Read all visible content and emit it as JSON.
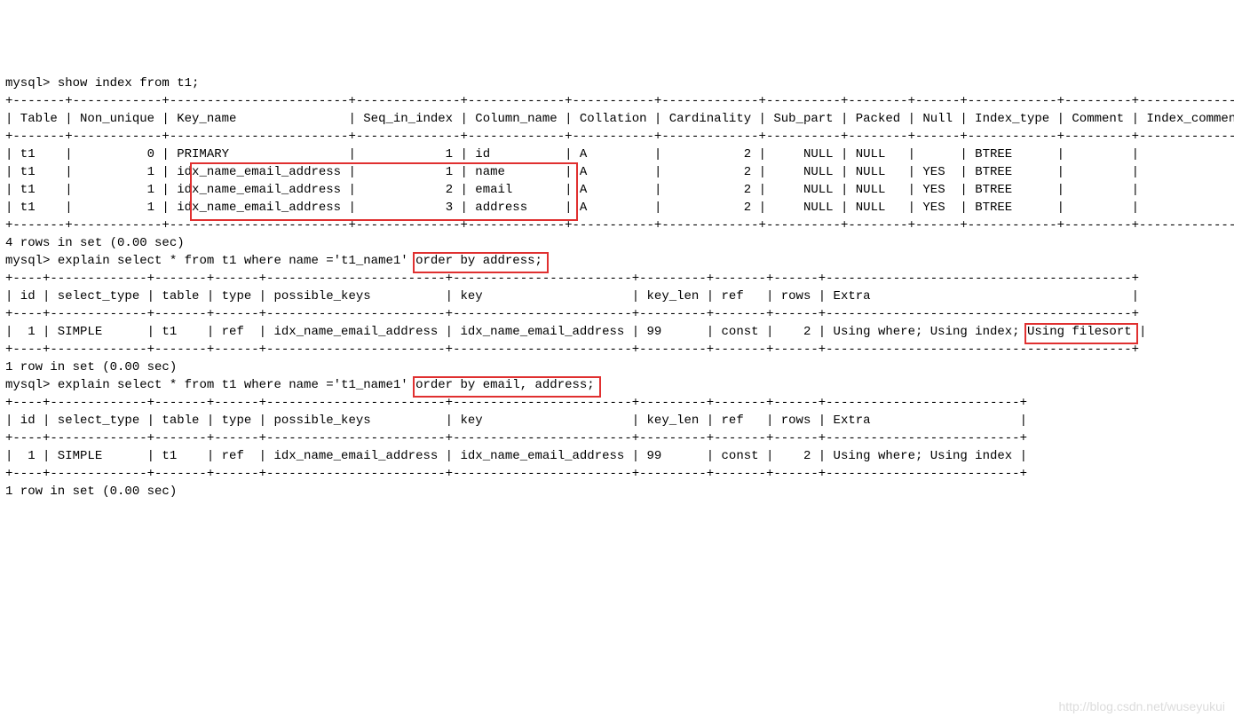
{
  "prompt": "mysql>",
  "cmd1": "show index from t1;",
  "border_top1": "+-------+------------+------------------------+--------------+-------------+-----------+-------------+----------+--------+------+------------+---------+---------------+",
  "header1": "| Table | Non_unique | Key_name               | Seq_in_index | Column_name | Collation | Cardinality | Sub_part | Packed | Null | Index_type | Comment | Index_comment |",
  "row1a": "| t1    |          0 | PRIMARY                |            1 | id          | A         |           2 |     NULL | NULL   |      | BTREE      |         |               |",
  "row1b": "| t1    |          1 | idx_name_email_address |            1 | name        | A         |           2 |     NULL | NULL   | YES  | BTREE      |         |               |",
  "row1c": "| t1    |          1 | idx_name_email_address |            2 | email       | A         |           2 |     NULL | NULL   | YES  | BTREE      |         |               |",
  "row1d": "| t1    |          1 | idx_name_email_address |            3 | address     | A         |           2 |     NULL | NULL   | YES  | BTREE      |         |               |",
  "result1": "4 rows in set (0.00 sec)",
  "blank": "",
  "cmd2_a": "explain select * from t1 where name ='t1_name1' ",
  "cmd2_b": "order by address;",
  "border_top2": "+----+-------------+-------+------+------------------------+------------------------+---------+-------+------+-----------------------------------------+",
  "header2": "| id | select_type | table | type | possible_keys          | key                    | key_len | ref   | rows | Extra                                   |",
  "row2_a": "|  1 | SIMPLE      | t1    | ref  | idx_name_email_address | idx_name_email_address | 99      | const |    2 | Using where; Using index; ",
  "row2_b": "Using filesort",
  "row2_c": " |",
  "result2": "1 row in set (0.00 sec)",
  "cmd3_a": "explain select * from t1 where name ='t1_name1' ",
  "cmd3_b": "order by email, address;",
  "border_top3": "+----+-------------+-------+------+------------------------+------------------------+---------+-------+------+--------------------------+",
  "header3": "| id | select_type | table | type | possible_keys          | key                    | key_len | ref   | rows | Extra                    |",
  "row3": "|  1 | SIMPLE      | t1    | ref  | idx_name_email_address | idx_name_email_address | 99      | const |    2 | Using where; Using index |",
  "result3": "1 row in set (0.00 sec)",
  "watermark": "http://blog.csdn.net/wuseyukui",
  "chart_data": {
    "type": "table",
    "tables": [
      {
        "title": "show index from t1",
        "columns": [
          "Table",
          "Non_unique",
          "Key_name",
          "Seq_in_index",
          "Column_name",
          "Collation",
          "Cardinality",
          "Sub_part",
          "Packed",
          "Null",
          "Index_type",
          "Comment",
          "Index_comment"
        ],
        "rows": [
          [
            "t1",
            0,
            "PRIMARY",
            1,
            "id",
            "A",
            2,
            "NULL",
            "NULL",
            "",
            "BTREE",
            "",
            ""
          ],
          [
            "t1",
            1,
            "idx_name_email_address",
            1,
            "name",
            "A",
            2,
            "NULL",
            "NULL",
            "YES",
            "BTREE",
            "",
            ""
          ],
          [
            "t1",
            1,
            "idx_name_email_address",
            2,
            "email",
            "A",
            2,
            "NULL",
            "NULL",
            "YES",
            "BTREE",
            "",
            ""
          ],
          [
            "t1",
            1,
            "idx_name_email_address",
            3,
            "address",
            "A",
            2,
            "NULL",
            "NULL",
            "YES",
            "BTREE",
            "",
            ""
          ]
        ]
      },
      {
        "title": "explain select * from t1 where name ='t1_name1' order by address",
        "columns": [
          "id",
          "select_type",
          "table",
          "type",
          "possible_keys",
          "key",
          "key_len",
          "ref",
          "rows",
          "Extra"
        ],
        "rows": [
          [
            1,
            "SIMPLE",
            "t1",
            "ref",
            "idx_name_email_address",
            "idx_name_email_address",
            99,
            "const",
            2,
            "Using where; Using index; Using filesort"
          ]
        ]
      },
      {
        "title": "explain select * from t1 where name ='t1_name1' order by email, address",
        "columns": [
          "id",
          "select_type",
          "table",
          "type",
          "possible_keys",
          "key",
          "key_len",
          "ref",
          "rows",
          "Extra"
        ],
        "rows": [
          [
            1,
            "SIMPLE",
            "t1",
            "ref",
            "idx_name_email_address",
            "idx_name_email_address",
            99,
            "const",
            2,
            "Using where; Using index"
          ]
        ]
      }
    ]
  }
}
